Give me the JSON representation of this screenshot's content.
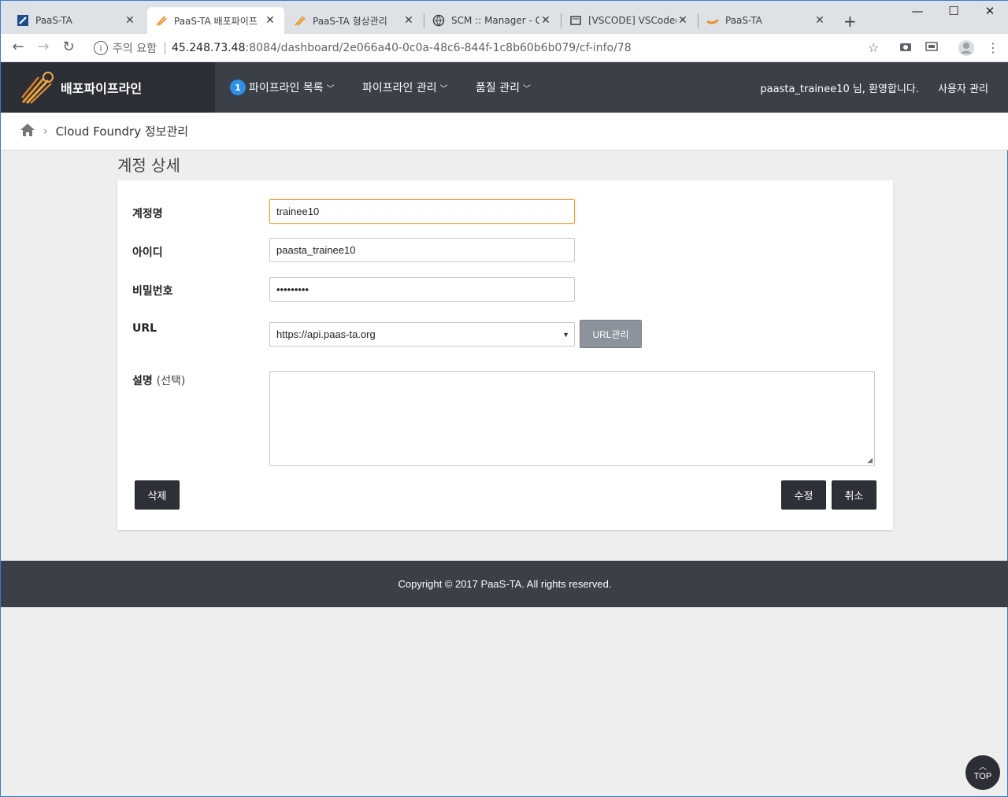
{
  "browser": {
    "tabs": [
      {
        "title": "PaaS-TA",
        "icon": "paasta-icon"
      },
      {
        "title": "PaaS-TA 배포파이프",
        "icon": "pipeline-logo-icon"
      },
      {
        "title": "PaaS-TA 형상관리",
        "icon": "pipeline-logo-icon"
      },
      {
        "title": "SCM :: Manager - Gi",
        "icon": "globe-icon"
      },
      {
        "title": "[VSCODE] VSCode@",
        "icon": "vscode-icon"
      },
      {
        "title": "PaaS-TA",
        "icon": "paasta-cloud-icon"
      }
    ],
    "security_label": "주의 요함",
    "url_host": "45.248.73.48",
    "url_path": ":8084/dashboard/2e066a40-0c0a-48c6-844f-1c8b60b6b079/cf-info/78"
  },
  "header": {
    "brand": "배포파이프라인",
    "badge": "1",
    "menu": [
      "파이프라인 목록",
      "파이프라인 관리",
      "품질 관리"
    ],
    "welcome": "paasta_trainee10 님, 환영합니다.",
    "user_mgmt": "사용자 관리"
  },
  "breadcrumb": {
    "current": "Cloud Foundry 정보관리"
  },
  "page": {
    "title": "계정 상세"
  },
  "form": {
    "account_name_label": "계정명",
    "account_name_value": "trainee10",
    "id_label": "아이디",
    "id_value": "paasta_trainee10",
    "password_label": "비밀번호",
    "password_value": "•••••••••",
    "url_label": "URL",
    "url_selected": "https://api.paas-ta.org",
    "url_manage_button": "URL관리",
    "description_label": "설명",
    "description_optional": "(선택)",
    "delete_button": "삭제",
    "edit_button": "수정",
    "cancel_button": "취소"
  },
  "footer": {
    "copyright": "Copyright © 2017 PaaS-TA. All rights reserved."
  },
  "top_button": "TOP",
  "colors": {
    "header_bg": "#3b3f47",
    "brand_bg": "#2b2e35",
    "badge": "#2f8ee5",
    "focus_border": "#e3a23a",
    "button_dark": "#2d3137"
  }
}
